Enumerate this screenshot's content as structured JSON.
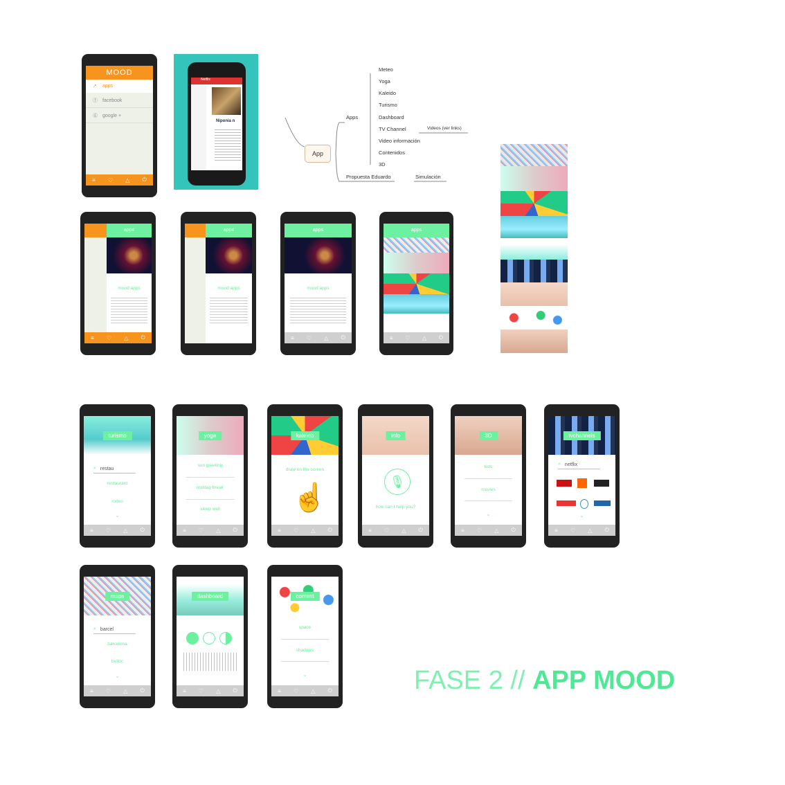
{
  "title": {
    "light": "FASE 2 //",
    "bold": "APP MOOD"
  },
  "menu_phone": {
    "logo": "MOOD",
    "items": [
      "apps",
      "facebook",
      "google +"
    ]
  },
  "photo_phone": {
    "tab1": "Netflix",
    "heading": "Niponia n"
  },
  "mindmap": {
    "root": "App",
    "apps": "Apps",
    "apps_children": [
      "Meteo",
      "Yoga",
      "Kaleido",
      "Turismo",
      "Dashboard",
      "TV Channel",
      "Video información",
      "Contenidos",
      "3D"
    ],
    "tv_child": "Videos (ver links)",
    "proposal": "Propuesta Eduardo",
    "proposal_child": "Simulación"
  },
  "apps_screen": {
    "header": "apps",
    "subtitle": "mood apps"
  },
  "screens": {
    "turismo": {
      "label": "turismo",
      "search": "restau",
      "items": [
        "restaurant",
        "rodeo"
      ]
    },
    "yoga": {
      "label": "yoga",
      "items": [
        "sun greeting",
        "midday break",
        "sleep well"
      ]
    },
    "kaleido": {
      "label": "kaleido",
      "hint": "draw on the screen"
    },
    "info": {
      "label": "info",
      "hint": "how can I help you?"
    },
    "3d": {
      "label": "3D",
      "items": [
        "kids",
        "movies"
      ]
    },
    "tv": {
      "label": "tvchannels",
      "search": "netflix"
    },
    "maps": {
      "label": "maps",
      "search": "barcel",
      "items": [
        "barcelona",
        "belloc"
      ]
    },
    "dashboard": {
      "label": "dashboard"
    },
    "content": {
      "label": "content",
      "items": [
        "space",
        "shadows"
      ]
    }
  },
  "colors": {
    "mint": "#6df0a0",
    "orange": "#f7941d",
    "phone": "#222222"
  }
}
